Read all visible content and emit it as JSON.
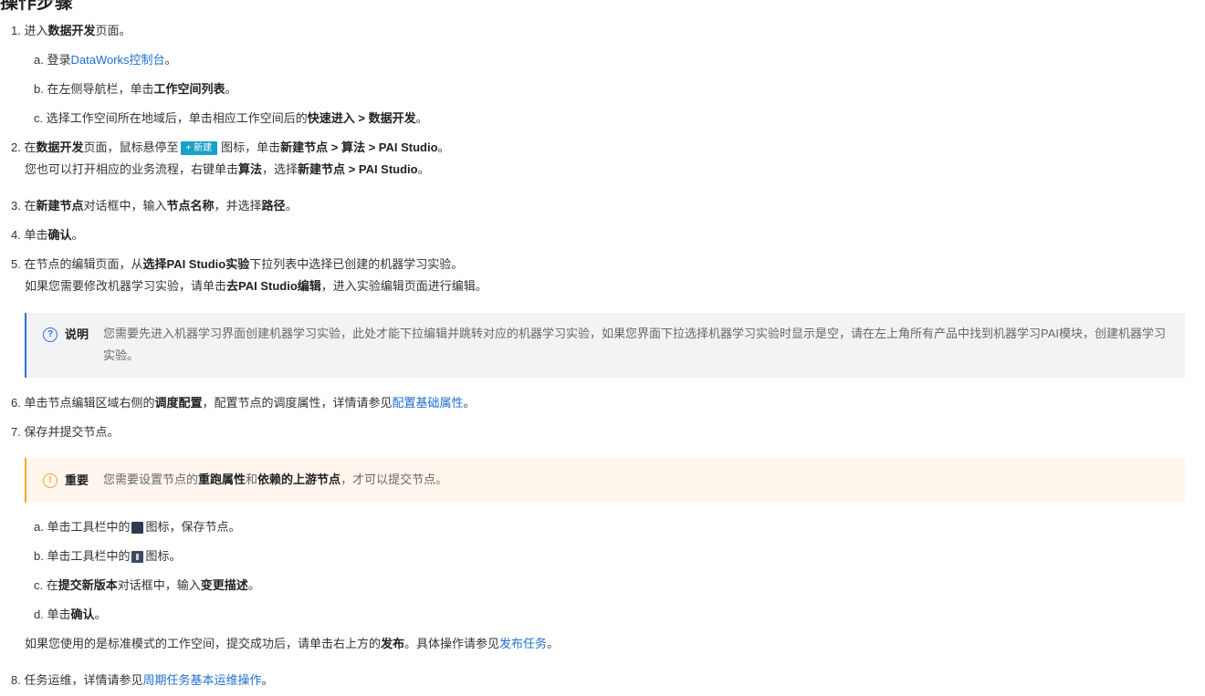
{
  "heading": "操作步骤",
  "steps": {
    "s1": {
      "num": "1.",
      "t1": "进入",
      "b1": "数据开发",
      "t2": "页面。"
    },
    "s1a": {
      "num": "a.",
      "t1": "登录",
      "link": "DataWorks控制台",
      "t2": "。"
    },
    "s1b": {
      "num": "b.",
      "t1": "在左侧导航栏，单击",
      "b1": "工作空间列表",
      "t2": "。"
    },
    "s1c": {
      "num": "c.",
      "t1": "选择工作空间所在地域后，单击相应工作空间后的",
      "b1": "快速进入 > 数据开发",
      "t2": "。"
    },
    "s2": {
      "num": "2.",
      "t1": "在",
      "b1": "数据开发",
      "t2": "页面，鼠标悬停至",
      "btn": "+ 新建",
      "t3": "图标，单击",
      "b2": "新建节点 > 算法 > PAI Studio",
      "t4": "。"
    },
    "s2b": {
      "t1": "您也可以打开相应的业务流程，右键单击",
      "b1": "算法",
      "t2": "，选择",
      "b2": "新建节点 > PAI Studio",
      "t3": "。"
    },
    "s3": {
      "num": "3.",
      "t1": "在",
      "b1": "新建节点",
      "t2": "对话框中，输入",
      "b2": "节点名称",
      "t3": "，并选择",
      "b3": "路径",
      "t4": "。"
    },
    "s4": {
      "num": "4.",
      "t1": "单击",
      "b1": "确认",
      "t2": "。"
    },
    "s5": {
      "num": "5.",
      "t1": "在节点的编辑页面，从",
      "b1": "选择PAI Studio实验",
      "t2": "下拉列表中选择已创建的机器学习实验。"
    },
    "s5b": {
      "t1": "如果您需要修改机器学习实验，请单击",
      "b1": "去PAI Studio编辑",
      "t2": "，进入实验编辑页面进行编辑。"
    },
    "note1": {
      "icon": "?",
      "label": "说明",
      "text": "您需要先进入机器学习界面创建机器学习实验，此处才能下拉编辑并跳转对应的机器学习实验，如果您界面下拉选择机器学习实验时显示是空，请在左上角所有产品中找到机器学习PAI模块，创建机器学习实验。"
    },
    "s6": {
      "num": "6.",
      "t1": "单击节点编辑区域右侧的",
      "b1": "调度配置",
      "t2": "，配置节点的调度属性，详情请参见",
      "link": "配置基础属性",
      "t3": "。"
    },
    "s7": {
      "num": "7.",
      "t1": "保存并提交节点。"
    },
    "note2": {
      "icon": "!",
      "label": "重要",
      "t1": "您需要设置节点的",
      "b1": "重跑属性",
      "t2": "和",
      "b2": "依赖的上游节点",
      "t3": "，才可以提交节点。"
    },
    "s7a": {
      "num": "a.",
      "t1": "单击工具栏中的",
      "t2": "图标，保存节点。"
    },
    "s7b": {
      "num": "b.",
      "t1": "单击工具栏中的",
      "t2": "图标。"
    },
    "s7c": {
      "num": "c.",
      "t1": "在",
      "b1": "提交新版本",
      "t2": "对话框中，输入",
      "b2": "变更描述",
      "t3": "。"
    },
    "s7d": {
      "num": "d.",
      "t1": "单击",
      "b1": "确认",
      "t2": "。"
    },
    "s7e": {
      "t1": "如果您使用的是标准模式的工作空间，提交成功后，请单击右上方的",
      "b1": "发布",
      "t2": "。具体操作请参见",
      "link": "发布任务",
      "t3": "。"
    },
    "s8": {
      "num": "8.",
      "t1": "任务运维，详情请参见",
      "link": "周期任务基本运维操作",
      "t2": "。"
    }
  },
  "colors": {
    "link": "#1f6fd1",
    "info_border": "#2f6fd6",
    "warn_border": "#f5a623",
    "new_button": "#1aa1c9"
  },
  "icons": {
    "info": "question-circle-icon",
    "warn": "exclamation-circle-icon",
    "save": "save-icon",
    "submit": "submit-icon"
  }
}
